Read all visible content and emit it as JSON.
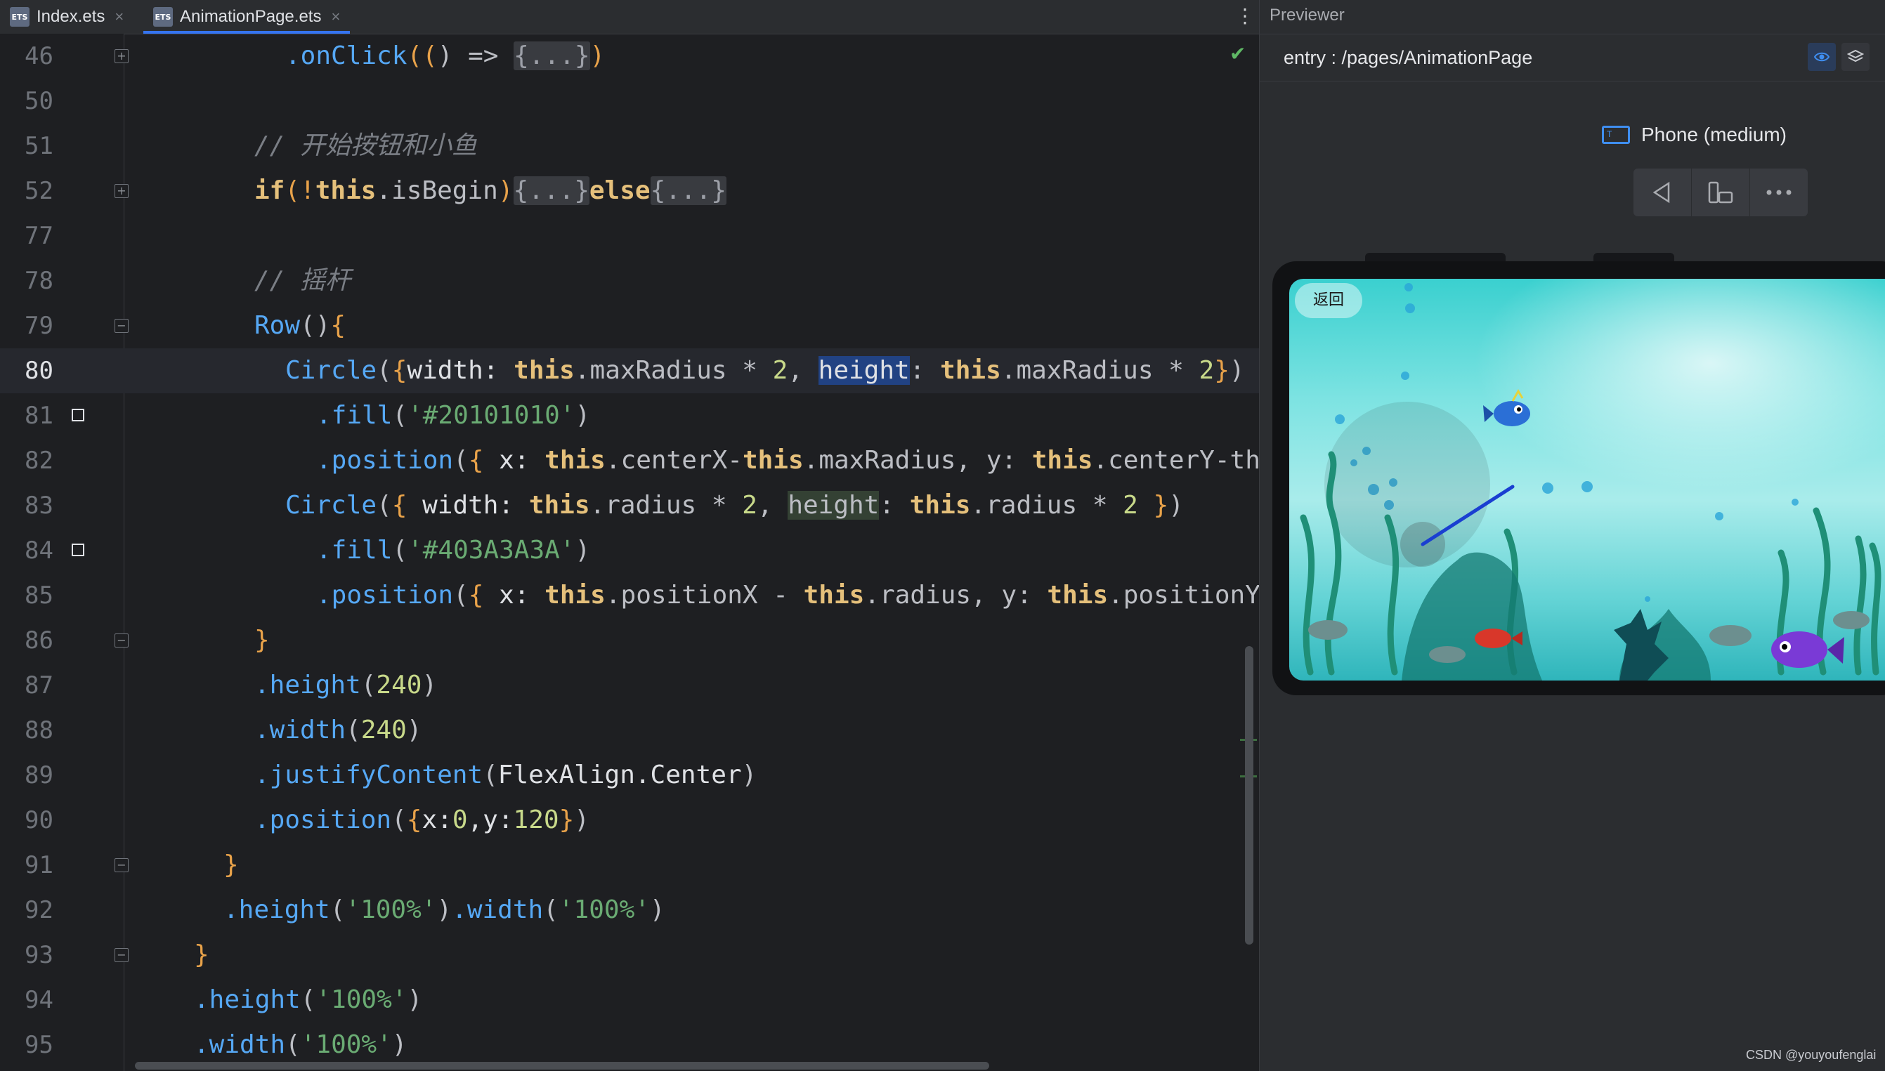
{
  "tabs": [
    {
      "label": "Index.ets",
      "badge": "ETS",
      "active": false
    },
    {
      "label": "AnimationPage.ets",
      "badge": "ETS",
      "active": true
    }
  ],
  "previewer": {
    "title": "Previewer",
    "entry": "entry : /pages/AnimationPage",
    "device": "Phone (medium)",
    "device_icon_letter": "T",
    "back_label": "返回",
    "credit": "CSDN @youyoufenglai"
  },
  "code_lines": [
    {
      "n": "46"
    },
    {
      "n": "50"
    },
    {
      "n": "51"
    },
    {
      "n": "52"
    },
    {
      "n": "77"
    },
    {
      "n": "78"
    },
    {
      "n": "79"
    },
    {
      "n": "80"
    },
    {
      "n": "81"
    },
    {
      "n": "82"
    },
    {
      "n": "83"
    },
    {
      "n": "84"
    },
    {
      "n": "85"
    },
    {
      "n": "86"
    },
    {
      "n": "87"
    },
    {
      "n": "88"
    },
    {
      "n": "89"
    },
    {
      "n": "90"
    },
    {
      "n": "91"
    },
    {
      "n": "92"
    },
    {
      "n": "93"
    },
    {
      "n": "94"
    },
    {
      "n": "95"
    }
  ],
  "code": {
    "l46": {
      "a": ".onClick",
      "b": "((",
      "c": ") => ",
      "fold": "{...}",
      "d": ")"
    },
    "l51": {
      "comment": "// 开始按钮和小鱼"
    },
    "l52": {
      "kw": "if",
      "a": "(!",
      "this": "this",
      "b": ".isBegin",
      "c": ")",
      "fold1": "{...}",
      "else": "else",
      "fold2": "{...}"
    },
    "l78": {
      "comment": "// 摇杆"
    },
    "l79": {
      "fn": "Row",
      "a": "()",
      "b": "{"
    },
    "l80": {
      "fn": "Circle",
      "a": "(",
      "b": "{",
      "c": "width: ",
      "this1": "this",
      "d": ".maxRadius * ",
      "n1": "2",
      "e": ", ",
      "sel": "height",
      "f": ": ",
      "this2": "this",
      "g": ".maxRadius * ",
      "n2": "2",
      "h": "}",
      "i": ")"
    },
    "l81": {
      "fn": ".fill",
      "a": "(",
      "s": "'#20101010'",
      "b": ")"
    },
    "l82": {
      "fn": ".position",
      "a": "(",
      "b": "{ ",
      "c": "x: ",
      "this1": "this",
      "d": ".centerX-",
      "this2": "this",
      "e": ".maxRadius, y: ",
      "this3": "this",
      "f": ".centerY-th"
    },
    "l83": {
      "fn": "Circle",
      "a": "(",
      "b": "{ ",
      "c": "width: ",
      "this1": "this",
      "d": ".radius * ",
      "n1": "2",
      "e": ", ",
      "hl": "height",
      "f": ": ",
      "this2": "this",
      "g": ".radius * ",
      "n2": "2",
      "h": " }",
      "i": ")"
    },
    "l84": {
      "fn": ".fill",
      "a": "(",
      "s": "'#403A3A3A'",
      "b": ")"
    },
    "l85": {
      "fn": ".position",
      "a": "(",
      "b": "{ ",
      "c": "x: ",
      "this1": "this",
      "d": ".positionX - ",
      "this2": "this",
      "e": ".radius, y: ",
      "this3": "this",
      "f": ".positionY"
    },
    "l86": {
      "a": "}"
    },
    "l87": {
      "fn": ".height",
      "a": "(",
      "n": "240",
      "b": ")"
    },
    "l88": {
      "fn": ".width",
      "a": "(",
      "n": "240",
      "b": ")"
    },
    "l89": {
      "fn": ".justifyContent",
      "a": "(",
      "t": "FlexAlign.Center",
      "b": ")"
    },
    "l90": {
      "fn": ".position",
      "a": "(",
      "b": "{",
      "c": "x:",
      "n1": "0",
      "d": ",y:",
      "n2": "120",
      "e": "}",
      "f": ")"
    },
    "l91": {
      "a": "}"
    },
    "l92": {
      "fn1": ".height",
      "a": "(",
      "s1": "'100%'",
      "b": ")",
      "fn2": ".width",
      "c": "(",
      "s2": "'100%'",
      "d": ")"
    },
    "l93": {
      "a": "}"
    },
    "l94": {
      "fn": ".height",
      "a": "(",
      "s": "'100%'",
      "b": ")"
    },
    "l95": {
      "fn": ".width",
      "a": "(",
      "s": "'100%'",
      "b": ")"
    }
  },
  "colors": {
    "accent": "#3574f0",
    "editor_bg": "#1e1f22",
    "selection": "#214283",
    "joystick_line": "#1a3fd1"
  }
}
